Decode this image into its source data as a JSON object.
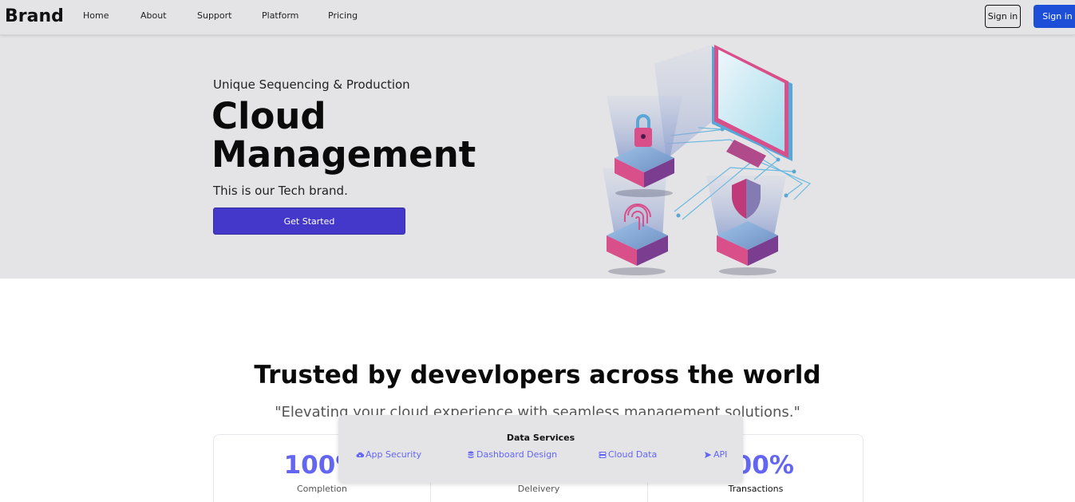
{
  "navbar": {
    "brand": "Brand",
    "links": [
      "Home",
      "About",
      "Support",
      "Platform",
      "Pricing"
    ],
    "signin_outline": "Sign in",
    "signin_solid": "Sign in"
  },
  "hero": {
    "eyebrow": "Unique Sequencing & Production",
    "title_line1": "Cloud",
    "title_line2": "Management",
    "subtitle": "This is our Tech brand.",
    "cta": "Get Started"
  },
  "trusted": {
    "title": "Trusted by devevlopers across the world",
    "quote": "\"Elevating your cloud experience with seamless management solutions.\""
  },
  "stats": [
    {
      "value": "100%",
      "label": "Completion"
    },
    {
      "value": "",
      "label": "Deleivery"
    },
    {
      "value": "100%",
      "label": "Transactions"
    }
  ],
  "popup": {
    "title": "Data Services",
    "items": [
      {
        "label": "App Security",
        "icon": "cloud-lock-icon"
      },
      {
        "label": "Dashboard Design",
        "icon": "database-icon"
      },
      {
        "label": "Cloud Data",
        "icon": "server-icon"
      },
      {
        "label": "API",
        "icon": "send-icon"
      }
    ]
  },
  "colors": {
    "accent": "#6366f1",
    "cta": "#4338ca",
    "signin": "#1d4ed8",
    "hero_bg": "#e4e4e7",
    "illustration_pink": "#e0407a",
    "illustration_blue": "#5aa6d6"
  }
}
